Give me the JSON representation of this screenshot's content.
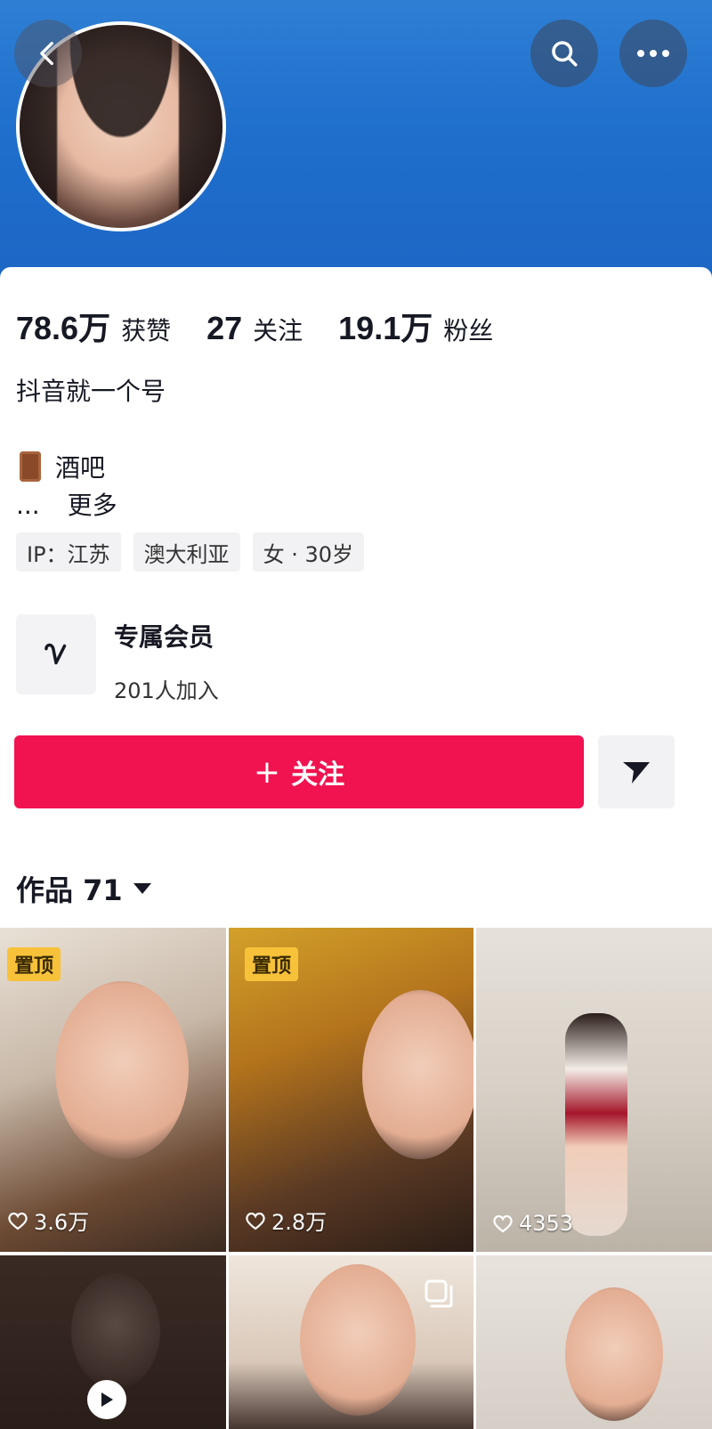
{
  "header": {
    "back_icon": "chevron-left-icon",
    "search_icon": "search-icon",
    "more_icon": "more-horizontal-icon"
  },
  "stats": [
    {
      "value": "78.6万",
      "label": "获赞"
    },
    {
      "value": "27",
      "label": "关注"
    },
    {
      "value": "19.1万",
      "label": "粉丝"
    }
  ],
  "bio": "抖音就一个号",
  "tag": {
    "icon": "door-icon",
    "text": "酒吧"
  },
  "more": {
    "dots": "...",
    "label": "更多"
  },
  "chips": [
    "IP：江苏",
    "澳大利亚",
    "女 · 30岁"
  ],
  "member": {
    "icon": "heart-outline-icon",
    "title": "专属会员",
    "subtitle": "201人加入"
  },
  "actions": {
    "follow_label": "关注",
    "follow_icon": "plus-icon",
    "share_icon": "send-icon"
  },
  "works": {
    "label": "作品 71",
    "caret_icon": "caret-down-icon"
  },
  "videos": [
    {
      "pinned": true,
      "pin_label": "置顶",
      "likes": "3.6万"
    },
    {
      "pinned": true,
      "pin_label": "置顶",
      "likes": "2.8万"
    },
    {
      "pinned": false,
      "likes": "4353"
    },
    {
      "pinned": false,
      "likes": ""
    },
    {
      "pinned": false,
      "likes": ""
    },
    {
      "pinned": false,
      "likes": ""
    }
  ],
  "colors": {
    "header": "#1f6fcd",
    "follow_button": "#f0134f",
    "pin_badge": "#f7c23a"
  }
}
